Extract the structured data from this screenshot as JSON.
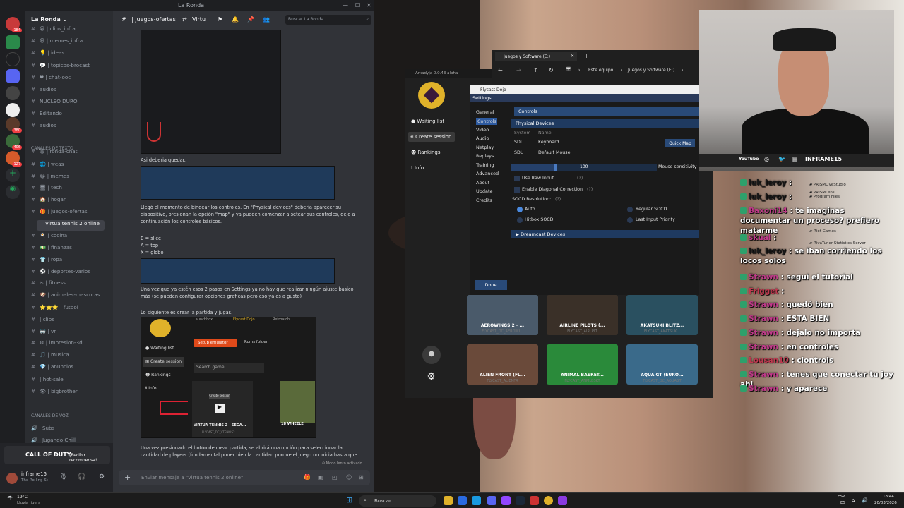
{
  "discord": {
    "window_title": "La Ronda",
    "server_name": "La Ronda",
    "channel_title": "| juegos-ofertas",
    "thread_title": "Virtu",
    "search_placeholder": "Buscar La Ronda",
    "server_badges": [
      "184",
      "380",
      "406",
      "127"
    ],
    "channels": [
      {
        "name": "| clips_infra",
        "emoji": "😀"
      },
      {
        "name": "| memes_infra",
        "emoji": "😆"
      },
      {
        "name": "| ideas",
        "emoji": "💡"
      },
      {
        "name": "| topicos-brocast",
        "emoji": "💬"
      },
      {
        "name": "| chat-ooc",
        "emoji": "❤"
      },
      {
        "name": "audios",
        "emoji": ""
      },
      {
        "name": "NUCLEO DURO",
        "emoji": ""
      },
      {
        "name": "Editando",
        "emoji": ""
      },
      {
        "name": "audios",
        "emoji": ""
      },
      {
        "name": "| ronda-chat",
        "emoji": "😀"
      },
      {
        "name": "| weas",
        "emoji": "🌐"
      },
      {
        "name": "| memes",
        "emoji": "😂"
      },
      {
        "name": "| tech",
        "emoji": "🖥"
      },
      {
        "name": "| hogar",
        "emoji": "🏠"
      },
      {
        "name": "| juegos-ofertas",
        "emoji": "🎁"
      },
      {
        "name": "Virtua tennis 2 online",
        "emoji": ""
      },
      {
        "name": "| cocina",
        "emoji": "🍳"
      },
      {
        "name": "| finanzas",
        "emoji": "💵"
      },
      {
        "name": "| ropa",
        "emoji": "👕"
      },
      {
        "name": "| deportes-varios",
        "emoji": "⚽"
      },
      {
        "name": "| fitness",
        "emoji": "✂"
      },
      {
        "name": "| animales-mascotas",
        "emoji": "🐶"
      },
      {
        "name": "| futbol",
        "emoji": "⭐⭐⭐"
      },
      {
        "name": "| clips",
        "emoji": ""
      },
      {
        "name": "| vr",
        "emoji": "🥽"
      },
      {
        "name": "| impresion-3d",
        "emoji": "⚙"
      },
      {
        "name": "| musica",
        "emoji": "🎵"
      },
      {
        "name": "| anuncios",
        "emoji": "💎"
      },
      {
        "name": "| hot-sale",
        "emoji": ""
      },
      {
        "name": "| bigbrother",
        "emoji": "👁"
      }
    ],
    "section_text": "CANALES DE TEXTO",
    "section_voice": "Canales de voz",
    "voice_channels": [
      {
        "name": "| Subs",
        "emoji": "🔊"
      },
      {
        "name": "| Jugando Chill",
        "emoji": "🔊"
      }
    ],
    "cod_banner": {
      "title": "CALL OF DUTY",
      "cta": "¡Recibir recompensa!"
    },
    "user": {
      "name": "inframe15",
      "status": "The Rolling St"
    },
    "messages": [
      "Asi deberia quedar.",
      "Llegó el momento de bindear los controles. En \"Physical devices\" debería aparecer su dispositivo, presionan la opción \"map\" y ya pueden comenzar a setear sus controles, dejo a continuación los controles básicos.",
      "B = slice",
      "A = top",
      "X = globo",
      "Una vez que ya estén esos 2 pasos en Settings ya no hay que realizar ningún ajuste basico más (se pueden configurar opciones graficas pero eso ya es a gusto)",
      "Lo siguiente es crear la partida y jugar.",
      "Una vez presionado el botón de crear partida, se abrirá una opción para seleccionar la cantidad de players (fundamental poner bien la cantidad porque el juego no inicia hasta que"
    ],
    "embedded_shot": {
      "waiting": "Waiting list",
      "create": "Create session",
      "rankings": "Rankings",
      "info": "Info",
      "setup": "Setup emulator",
      "roms": "Roms folder",
      "search": "Search game",
      "create_tip": "Create session",
      "game": "VIRTUA TENNIS 2 - SEGA...",
      "game_sub": "FLYCAST_DC_VTENNIS2",
      "game2": "18 WHEELE",
      "tabs": [
        "Launchbox",
        "Flycast Dojo",
        "Retroarch"
      ]
    },
    "slow_mode": "Modo lento activado",
    "input_placeholder": "Enviar mensaje a \"Virtua tennis 2 online\""
  },
  "arkadyja": {
    "title": "Arkadyja 0.0.43 alpha",
    "menu": [
      "Waiting list",
      "Create session",
      "Rankings",
      "Info"
    ],
    "done": "Done",
    "games": [
      {
        "name": "AEROWINGS 2 - ...",
        "sub": "FLYCAST_DC_AEROWI..."
      },
      {
        "name": "AIRLINE PILOTS (...",
        "sub": "FLYCAST_AIRLPLT"
      },
      {
        "name": "AKATSUKI BLITZ...",
        "sub": "FLYCAST_AKATSUK..."
      },
      {
        "name": "ALIEN FRONT (FL...",
        "sub": "FLYCAST_ALIENFR"
      },
      {
        "name": "ANIMAL BASKET...",
        "sub": "FLYCAST_ANMLBSKT"
      },
      {
        "name": "AQUA GT (EURO...",
        "sub": "FLYCAST_DC_AQUAGT"
      }
    ]
  },
  "explorer": {
    "tab": "Juegos y Software (E:)",
    "crumbs": [
      "Este equipo",
      "Juegos y Software (E:)"
    ]
  },
  "flycast": {
    "title": "Flycast Dojo",
    "settings": "Settings",
    "menu": [
      "General",
      "Controls",
      "Video",
      "Audio",
      "Netplay",
      "Replays",
      "Training",
      "Advanced",
      "About",
      "Update",
      "Credits"
    ],
    "controls_header": "Controls",
    "physical_devices": "Physical Devices",
    "col_system": "System",
    "col_name": "Name",
    "devices": [
      {
        "system": "SDL",
        "name": "Keyboard"
      },
      {
        "system": "SDL",
        "name": "Default Mouse"
      }
    ],
    "quick_map": "Quick Map",
    "mouse_sensitivity_label": "Mouse sensitivity",
    "mouse_sensitivity": "100",
    "mouse_sensitivity_fraction": 0.3,
    "raw_input": "Use Raw Input",
    "diagonal": "Enable Diagonal Correction",
    "socd_label": "SOCD Resolution:",
    "socd_options": [
      "Auto",
      "Regular SOCD",
      "Hitbox SOCD",
      "Last Input Priority"
    ],
    "dreamcast_devices": "Dreamcast Devices"
  },
  "webcam": {
    "social": "INFRAME15"
  },
  "chat": [
    {
      "user": "luk_leroy",
      "text": " :",
      "cls": "u2"
    },
    {
      "user": "luk_leroy",
      "text": " :",
      "cls": "u2"
    },
    {
      "user": "Baxoni14",
      "text": " : te imaginas documentar un proceso? prefiero matarme",
      "cls": "u"
    },
    {
      "user": "skual",
      "text": " :",
      "cls": "u"
    },
    {
      "user": "luk_leroy",
      "text": " : se iban corriendo los locos solos",
      "cls": "u2"
    },
    {
      "user": "Strawn",
      "text": " : segui el tutorial",
      "cls": "u"
    },
    {
      "user": "Frigget",
      "text": " :",
      "cls": "u3"
    },
    {
      "user": "Strawn",
      "text": " : quedó bien",
      "cls": "u"
    },
    {
      "user": "Strawn",
      "text": " : ESTA BIEN",
      "cls": "u"
    },
    {
      "user": "Strawn",
      "text": " : dejalo no importa",
      "cls": "u"
    },
    {
      "user": "Strawn",
      "text": " : en controles",
      "cls": "u"
    },
    {
      "user": "Lousan10",
      "text": " : ciontrols",
      "cls": "u3"
    },
    {
      "user": "Strawn",
      "text": " : tenes que conectar tu joy ahi",
      "cls": "u"
    },
    {
      "user": "Strawn",
      "text": " : y aparece",
      "cls": "u"
    }
  ],
  "folders": [
    "PRISMLens",
    "PRISMLiveStudio",
    "Program Files",
    "Riot Games",
    "RivaTuner Statistics Server"
  ],
  "taskbar": {
    "weather": "19°C",
    "weather_desc": "Lluvia ligera",
    "search": "Buscar",
    "lang": "ESP",
    "lang2": "ES",
    "time": "18:44",
    "date": "20/03/2026"
  }
}
